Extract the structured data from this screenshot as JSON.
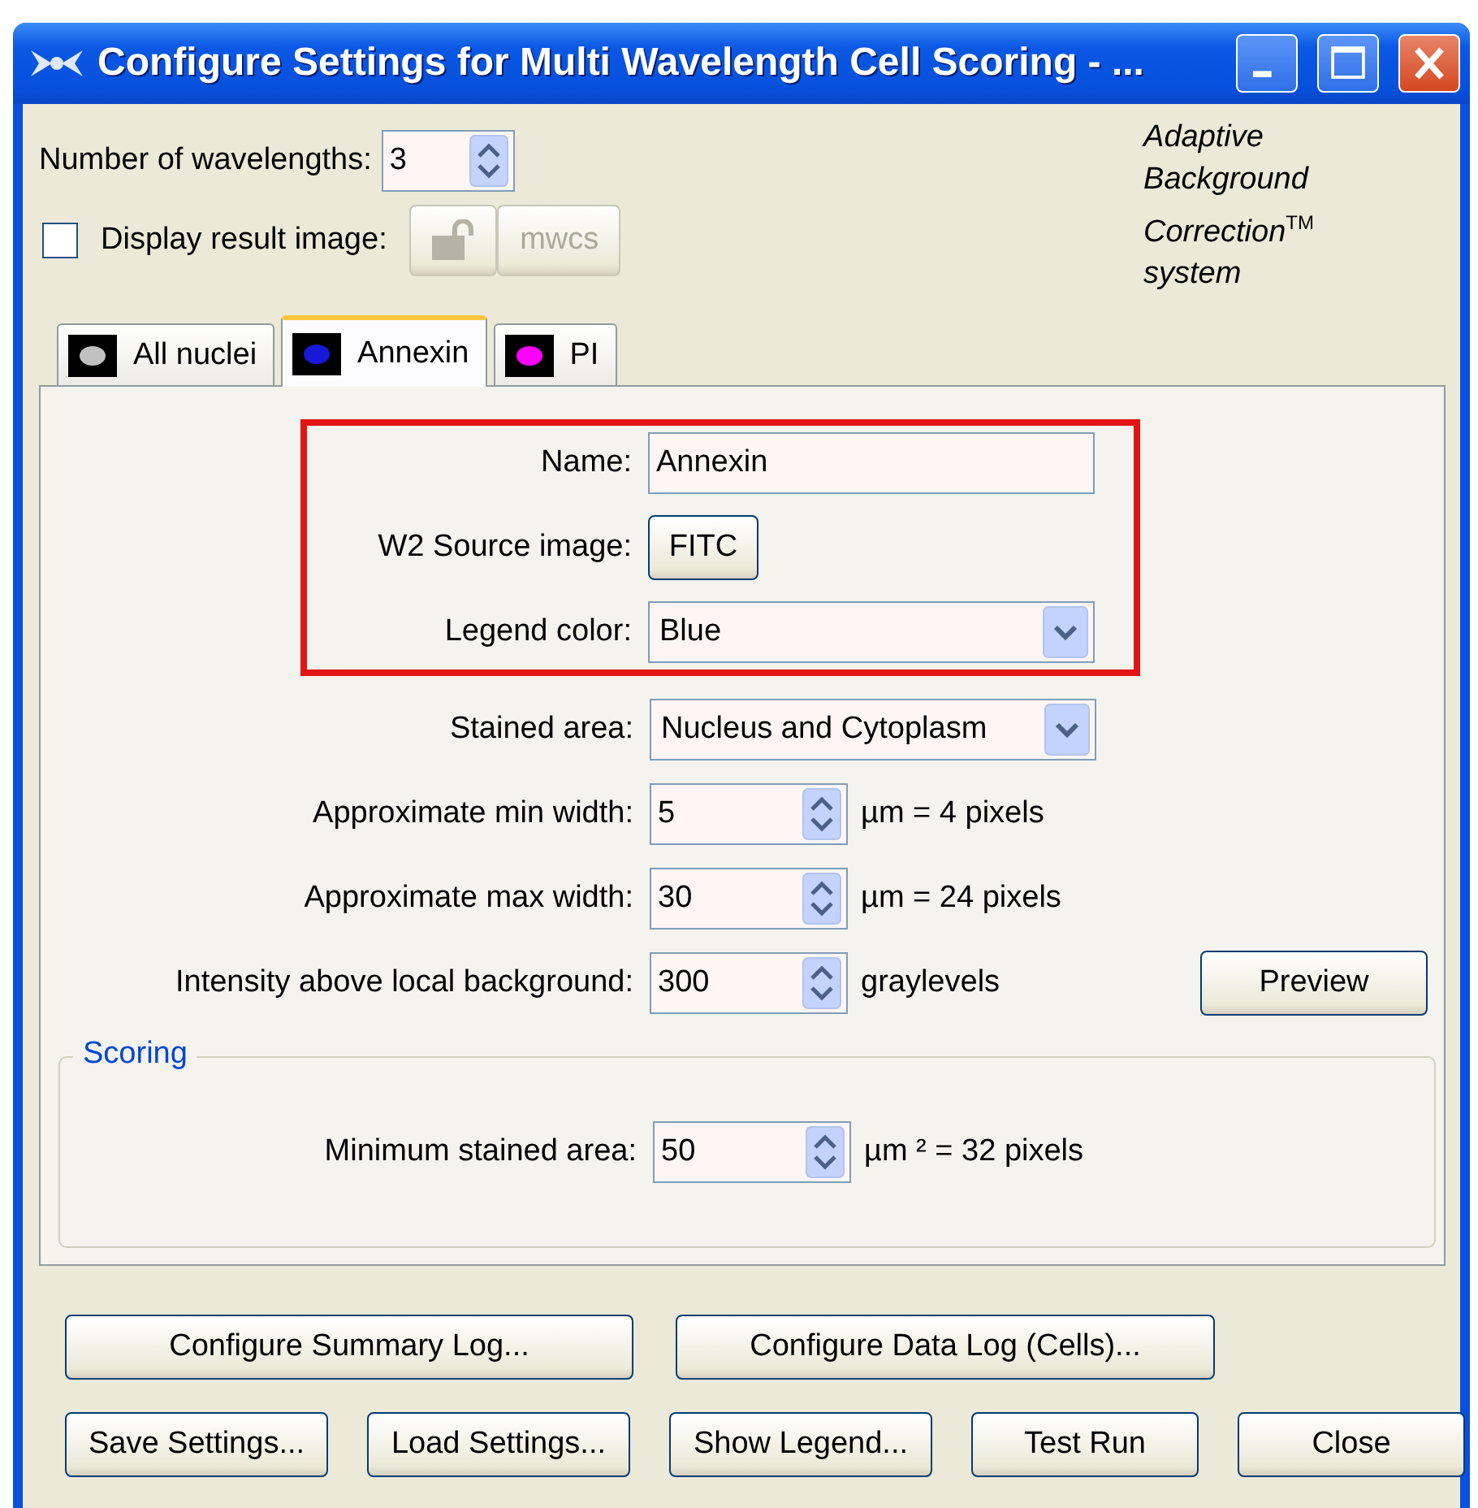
{
  "window": {
    "title": "Configure Settings for Multi Wavelength Cell Scoring - ..."
  },
  "wavelengths": {
    "label": "Number of wavelengths:",
    "value": "3"
  },
  "display_result": {
    "label": "Display result image:",
    "checked": false
  },
  "image_button": {
    "disabled": true
  },
  "mwcs_button": {
    "label": "mwcs",
    "disabled": true
  },
  "logo": {
    "lines": [
      "Adaptive",
      "Background",
      "Correction$^{TM}$",
      "system"
    ]
  },
  "tabs": [
    {
      "label": "All nuclei",
      "color": "#c0c0c0",
      "selected": false
    },
    {
      "label": "Annexin",
      "color": "#1818d8",
      "selected": true
    },
    {
      "label": "PI",
      "color": "#ff00ff",
      "selected": false
    }
  ],
  "fields": [
    {
      "kind": "text",
      "label": "Name:",
      "value": "Annexin",
      "highlighted": true
    },
    {
      "kind": "button",
      "label": "W2 Source image:",
      "value": "FITC",
      "highlighted": true
    },
    {
      "kind": "dropdown",
      "label": "Legend color:",
      "value": "Blue",
      "highlighted": true
    },
    {
      "kind": "dropdown",
      "label": "Stained area:",
      "value": "Nucleus and Cytoplasm",
      "highlighted": false
    },
    {
      "kind": "spin",
      "label": "Approximate min width:",
      "value": "5",
      "unit": "µm = 4 pixels",
      "highlighted": false
    },
    {
      "kind": "spin",
      "label": "Approximate max width:",
      "value": "30",
      "unit": "µm = 24 pixels",
      "highlighted": false
    },
    {
      "kind": "spin",
      "label": "Intensity above local background:",
      "value": "300",
      "unit": "graylevels",
      "highlighted": false
    }
  ],
  "preview_button": "Preview",
  "scoring": {
    "title": "Scoring",
    "fields": [
      {
        "kind": "spin",
        "label": "Minimum stained area:",
        "value": "50",
        "unit": "µm ² = 32 pixels"
      }
    ]
  },
  "button_rows": [
    [
      "Configure Summary Log...",
      "Configure Data Log (Cells)..."
    ],
    [
      "Save Settings...",
      "Load Settings...",
      "Show Legend...",
      "Test Run",
      "Close"
    ]
  ]
}
